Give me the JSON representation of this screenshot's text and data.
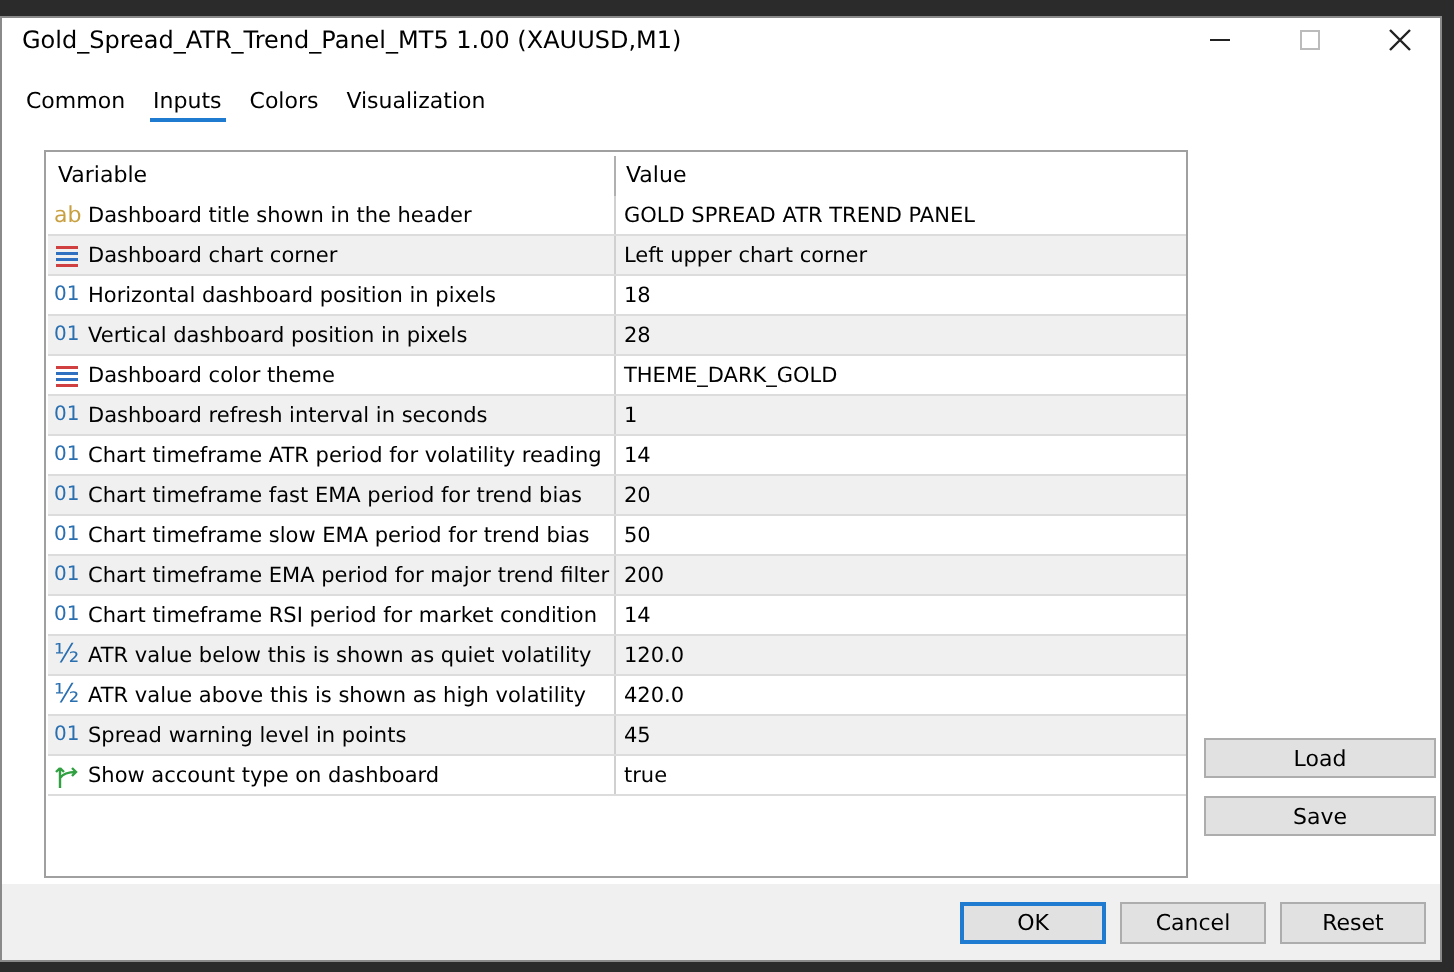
{
  "window": {
    "title": "Gold_Spread_ATR_Trend_Panel_MT5 1.00 (XAUUSD,M1)"
  },
  "tabs": [
    {
      "label": "Common",
      "selected": false
    },
    {
      "label": "Inputs",
      "selected": true
    },
    {
      "label": "Colors",
      "selected": false
    },
    {
      "label": "Visualization",
      "selected": false
    }
  ],
  "table": {
    "columns": [
      "Variable",
      "Value"
    ],
    "rows": [
      {
        "kind": "string",
        "icon": "ab",
        "variable": "Dashboard title shown in the header",
        "value": "GOLD SPREAD ATR TREND PANEL"
      },
      {
        "kind": "enum",
        "variable": "Dashboard chart corner",
        "value": "Left upper chart corner"
      },
      {
        "kind": "int",
        "icon": "01",
        "variable": "Horizontal dashboard position in pixels",
        "value": "18"
      },
      {
        "kind": "int",
        "icon": "01",
        "variable": "Vertical dashboard position in pixels",
        "value": "28"
      },
      {
        "kind": "enum",
        "variable": "Dashboard color theme",
        "value": "THEME_DARK_GOLD"
      },
      {
        "kind": "int",
        "icon": "01",
        "variable": "Dashboard refresh interval in seconds",
        "value": "1"
      },
      {
        "kind": "int",
        "icon": "01",
        "variable": "Chart timeframe ATR period for volatility reading",
        "value": "14"
      },
      {
        "kind": "int",
        "icon": "01",
        "variable": "Chart timeframe fast EMA period for trend bias",
        "value": "20"
      },
      {
        "kind": "int",
        "icon": "01",
        "variable": "Chart timeframe slow EMA period for trend bias",
        "value": "50"
      },
      {
        "kind": "int",
        "icon": "01",
        "variable": "Chart timeframe EMA period for major trend filter",
        "value": "200"
      },
      {
        "kind": "int",
        "icon": "01",
        "variable": "Chart timeframe RSI period for market condition",
        "value": "14"
      },
      {
        "kind": "double",
        "icon": "½",
        "variable": "ATR value below this is shown as quiet volatility",
        "value": "120.0"
      },
      {
        "kind": "double",
        "icon": "½",
        "variable": "ATR value above this is shown as high volatility",
        "value": "420.0"
      },
      {
        "kind": "int",
        "icon": "01",
        "variable": "Spread warning level in points",
        "value": "45"
      },
      {
        "kind": "bool",
        "variable": "Show account type on dashboard",
        "value": "true"
      }
    ]
  },
  "side_buttons": [
    "Load",
    "Save"
  ],
  "buttons": [
    {
      "label": "OK",
      "default": true
    },
    {
      "label": "Cancel",
      "default": false
    },
    {
      "label": "Reset",
      "default": false
    }
  ]
}
